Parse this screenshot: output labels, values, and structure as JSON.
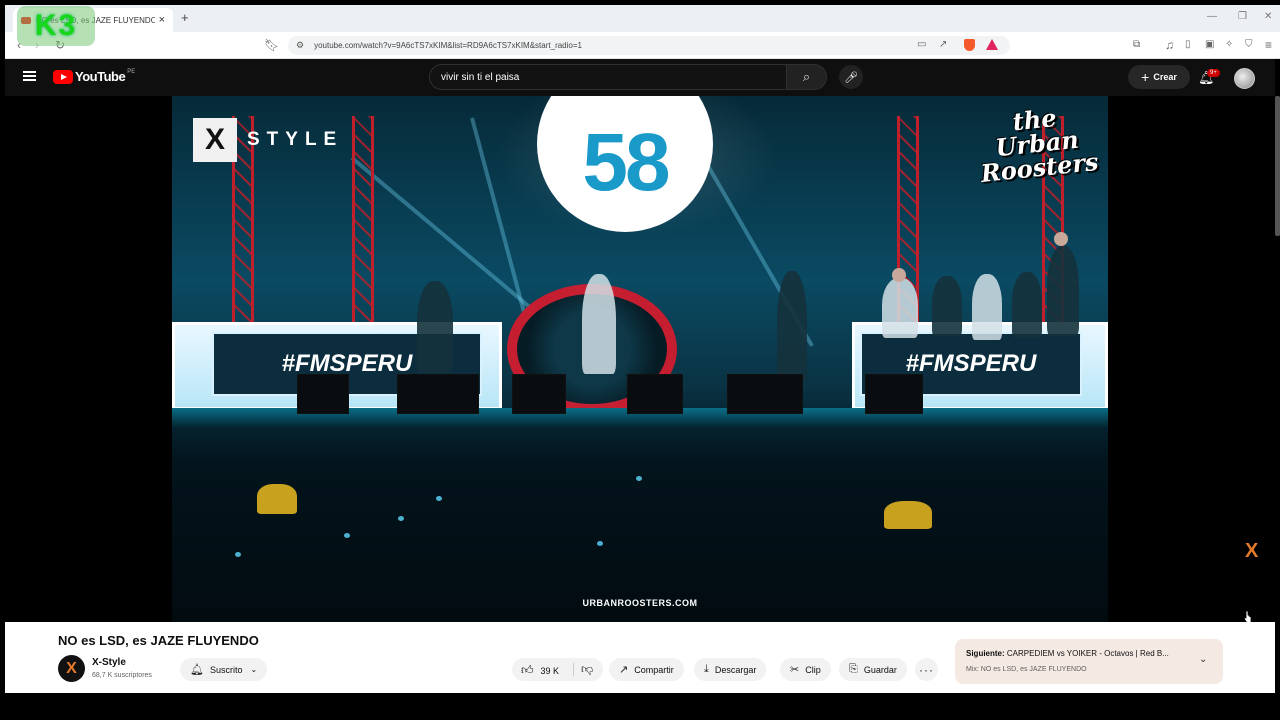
{
  "browser": {
    "tab_title": "NO es LSD, es JAZE FLUYENDO",
    "url": "youtube.com/watch?v=9A6cTS7xKIM&list=RD9A6cTS7xKIM&start_radio=1"
  },
  "overlay_logo": "K3",
  "youtube": {
    "logo_text": "YouTube",
    "country_code": "PE",
    "search_value": "vivir sin ti el paisa",
    "create_label": "Crear",
    "notification_count": "9+"
  },
  "video": {
    "score": "58",
    "brand_left": "STYLE",
    "brand_left_box": "X",
    "brand_right_1": "the Urban",
    "brand_right_2": "Roosters",
    "banner_left": "#FMSPERU",
    "banner_right": "#FMSPERU",
    "watermark": "URBANROOSTERS.COM"
  },
  "info": {
    "title": "NO es LSD, es JAZE FLUYENDO",
    "channel_name": "X-Style",
    "channel_initial": "X",
    "subscribers": "68,7 K suscriptores",
    "subscribe_label": "Suscrito",
    "likes": "39 K",
    "share_label": "Compartir",
    "download_label": "Descargar",
    "clip_label": "Clip",
    "save_label": "Guardar",
    "next_prefix": "Siguiente:",
    "next_title": "CARPEDIEM vs YOIKER - Octavos | Red B...",
    "next_mix": "Mix: NO es LSD, es JAZE FLUYENDO"
  },
  "side_mark": "X",
  "colors": {
    "accent_red": "#ff0000",
    "brand_orange": "#e67a2c",
    "score_blue": "#1a9ac8"
  }
}
